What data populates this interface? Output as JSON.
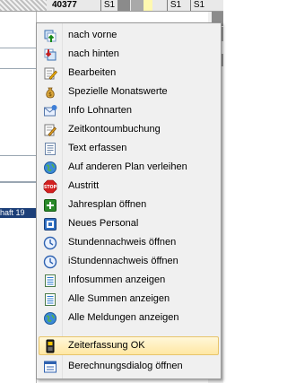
{
  "background": {
    "row_number": "40377",
    "shift_cells": [
      "S1",
      "S1",
      "S1"
    ],
    "navy_fragment": "haft 19"
  },
  "menu": {
    "items": [
      {
        "label": "nach vorne",
        "icon": "bring-forward-icon"
      },
      {
        "label": "nach hinten",
        "icon": "send-backward-icon"
      },
      {
        "label": "Bearbeiten",
        "icon": "edit-icon"
      },
      {
        "label": "Spezielle Monatswerte",
        "icon": "money-bag-icon"
      },
      {
        "label": "Info Lohnarten",
        "icon": "info-mail-icon"
      },
      {
        "label": "Zeitkontoumbuchung",
        "icon": "edit-pencil-icon"
      },
      {
        "label": "Text erfassen",
        "icon": "text-document-icon"
      },
      {
        "label": "Auf anderen Plan verleihen",
        "icon": "globe-icon"
      },
      {
        "label": "Austritt",
        "icon": "stop-icon"
      },
      {
        "label": "Jahresplan öffnen",
        "icon": "year-plan-icon"
      },
      {
        "label": "Neues Personal",
        "icon": "new-person-icon"
      },
      {
        "label": "Stundennachweis öffnen",
        "icon": "clock-icon"
      },
      {
        "label": "iStundennachweis öffnen",
        "icon": "clock-icon"
      },
      {
        "label": "Infosummen anzeigen",
        "icon": "list-document-icon"
      },
      {
        "label": "Alle Summen anzeigen",
        "icon": "list-document-icon"
      },
      {
        "label": "Alle Meldungen anzeigen",
        "icon": "globe-icon"
      },
      {
        "label": "Zeiterfassung OK",
        "icon": "time-clock-icon",
        "highlighted": true
      },
      {
        "label": "Berechnungsdialog öffnen",
        "icon": "calc-dialog-icon"
      }
    ]
  },
  "colors": {
    "menu_bg": "#f0f0f0",
    "highlight_bg": "#ffe7a3",
    "navy": "#1c3f78"
  }
}
